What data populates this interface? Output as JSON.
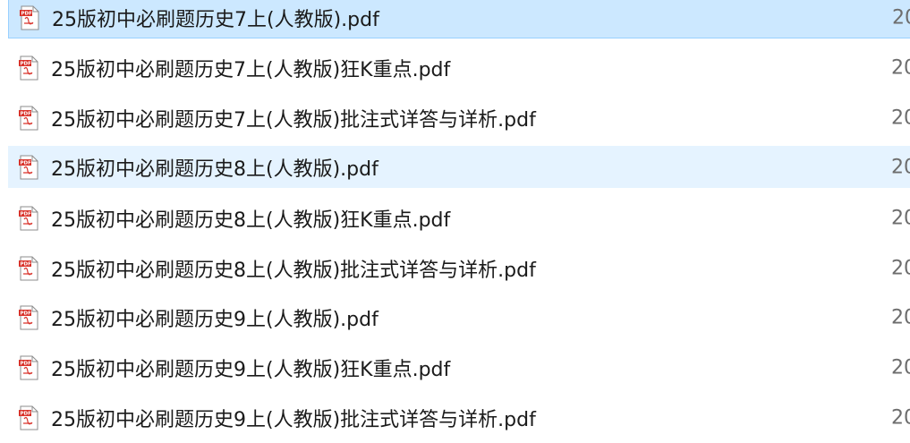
{
  "files": [
    {
      "name": "25版初中必刷题历史7上(人教版).pdf",
      "date": "20",
      "icon": "pdf-file-icon",
      "state": "selected"
    },
    {
      "name": "25版初中必刷题历史7上(人教版)狂K重点.pdf",
      "date": "20",
      "icon": "pdf-file-icon",
      "state": "normal"
    },
    {
      "name": "25版初中必刷题历史7上(人教版)批注式详答与详析.pdf",
      "date": "20",
      "icon": "pdf-file-icon",
      "state": "normal"
    },
    {
      "name": "25版初中必刷题历史8上(人教版).pdf",
      "date": "20",
      "icon": "pdf-file-icon",
      "state": "hover"
    },
    {
      "name": "25版初中必刷题历史8上(人教版)狂K重点.pdf",
      "date": "20",
      "icon": "pdf-file-icon",
      "state": "normal"
    },
    {
      "name": "25版初中必刷题历史8上(人教版)批注式详答与详析.pdf",
      "date": "20",
      "icon": "pdf-file-icon",
      "state": "normal"
    },
    {
      "name": "25版初中必刷题历史9上(人教版).pdf",
      "date": "20",
      "icon": "pdf-file-icon",
      "state": "normal"
    },
    {
      "name": "25版初中必刷题历史9上(人教版)狂K重点.pdf",
      "date": "20",
      "icon": "pdf-file-icon",
      "state": "normal"
    },
    {
      "name": "25版初中必刷题历史9上(人教版)批注式详答与详析.pdf",
      "date": "20",
      "icon": "pdf-file-icon",
      "state": "normal"
    }
  ],
  "colors": {
    "selected_bg": "#cce8ff",
    "selected_border": "#99d1ff",
    "hover_bg": "#e5f3ff",
    "pdf_red": "#d9332b"
  }
}
